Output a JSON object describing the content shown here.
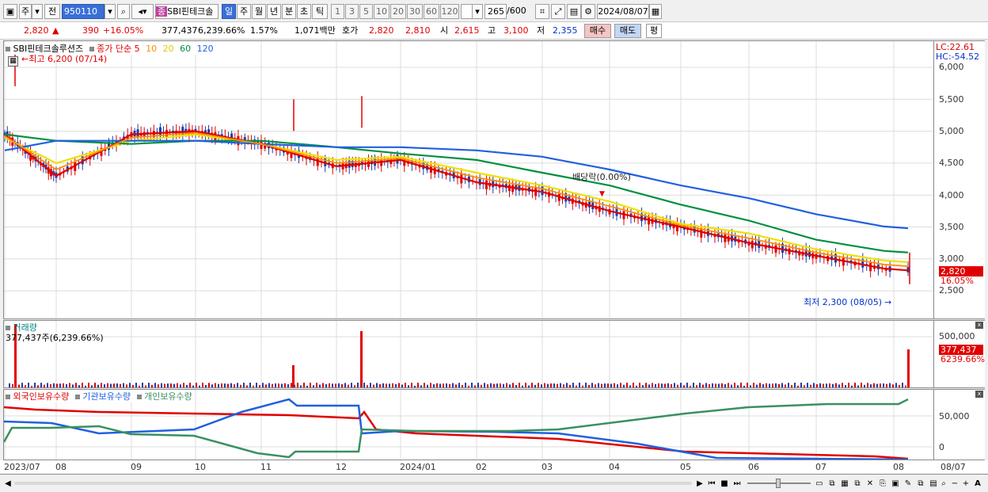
{
  "toolbar": {
    "mode1": "주",
    "mode2": "전",
    "code": "950110",
    "stock_badge": "종",
    "stock_name": "SBI핀테크솔",
    "periods": [
      "일",
      "주",
      "월",
      "년",
      "분",
      "초",
      "틱"
    ],
    "active_period": "일",
    "intervals": [
      "1",
      "3",
      "5",
      "10",
      "20",
      "30",
      "60",
      "120"
    ],
    "count": "265",
    "count_max": "/600",
    "date": "2024/08/07"
  },
  "info": {
    "price": "2,820",
    "arrow": "▲",
    "change": "390",
    "change_pct": "+16.05%",
    "volume": "377,437",
    "volume_pct": "6,239.66%",
    "turnover": "1.57%",
    "amount": "1,071백만",
    "quote_label": "호가",
    "ask": "2,820",
    "bid": "2,810",
    "open_label": "시",
    "open": "2,615",
    "high_label": "고",
    "high": "3,100",
    "low_label": "저",
    "low": "2,355",
    "buy_label": "매수",
    "sell_label": "매도",
    "avg_label": "평"
  },
  "price_panel": {
    "name": "SBI핀테크솔루션즈",
    "legend_label": "종가 단순",
    "ma_labels": [
      "5",
      "10",
      "20",
      "60",
      "120"
    ],
    "ma_colors": [
      "#e00000",
      "#ff8c00",
      "#f0e000",
      "#009040",
      "#2060e0"
    ],
    "high_note": "최고 6,200 (07/14)",
    "low_note": "최저 2,300 (08/05)",
    "ex_note": "배당락(0.00%)",
    "lc": "LC:22.61",
    "hc": "HC:-54.52",
    "y_ticks": [
      "6,000",
      "5,500",
      "5,000",
      "4,500",
      "4,000",
      "3,500",
      "3,000",
      "2,500"
    ],
    "last_price_tag": "2,820",
    "last_pct_tag": "16.05%"
  },
  "volume_panel": {
    "title": "거래량",
    "value": "377,437주(6,239.66%)",
    "y_tick": "500,000",
    "last_tag": "377,437",
    "last_pct_tag": "6239.66%"
  },
  "holders_panel": {
    "labels": [
      "외국인보유수량",
      "기관보유수량",
      "개인보유수량"
    ],
    "colors": [
      "#e00000",
      "#2060e0",
      "#3a9060"
    ],
    "y_ticks": [
      "50,000",
      "0"
    ]
  },
  "x_axis": [
    "2023/07",
    "08",
    "09",
    "10",
    "11",
    "12",
    "2024/01",
    "02",
    "03",
    "04",
    "05",
    "06",
    "07",
    "08"
  ],
  "x_axis_right": "08/07",
  "chart_data": {
    "type": "line",
    "title": "SBI핀테크솔루션즈",
    "ylim": [
      2200,
      6200
    ],
    "x": [
      "2023/07",
      "08",
      "09",
      "10",
      "11",
      "12",
      "2024/01",
      "02",
      "03",
      "04",
      "05",
      "06",
      "07",
      "08"
    ],
    "series": [
      {
        "name": "5",
        "values": [
          4950,
          4300,
          4950,
          5000,
          4800,
          4450,
          4550,
          4200,
          4050,
          3750,
          3500,
          3250,
          3050,
          2820
        ]
      },
      {
        "name": "20",
        "values": [
          4900,
          4500,
          4850,
          4950,
          4800,
          4550,
          4600,
          4350,
          4150,
          3900,
          3550,
          3400,
          3150,
          2950
        ]
      },
      {
        "name": "60",
        "values": [
          4950,
          4850,
          4800,
          4850,
          4850,
          4750,
          4650,
          4550,
          4350,
          4150,
          3850,
          3600,
          3300,
          3100
        ]
      },
      {
        "name": "120",
        "values": [
          4700,
          4850,
          4850,
          4850,
          4800,
          4750,
          4750,
          4700,
          4600,
          4400,
          4150,
          3950,
          3700,
          3480
        ]
      }
    ]
  }
}
